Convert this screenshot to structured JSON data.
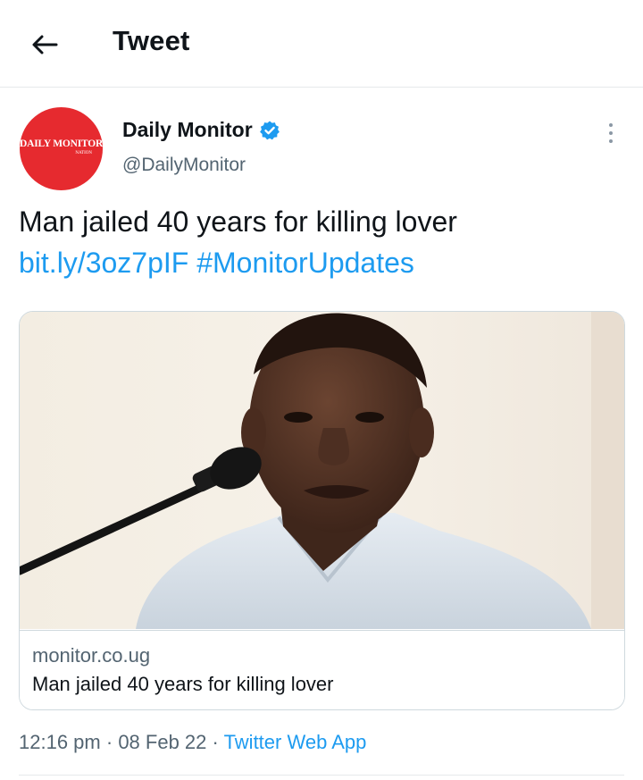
{
  "header": {
    "title": "Tweet",
    "back_icon": "back-arrow-icon"
  },
  "author": {
    "name": "Daily Monitor",
    "handle": "@DailyMonitor",
    "verified": true,
    "avatar_logo_main": "DAILY MONITOR",
    "avatar_logo_sub": "NATION",
    "avatar_color": "#e62a2f"
  },
  "tweet": {
    "text": "Man jailed 40 years for killing lover",
    "link": "bit.ly/3oz7pIF",
    "hashtag": "#MonitorUpdates"
  },
  "card": {
    "domain": "monitor.co.ug",
    "title": "Man jailed 40 years for killing lover",
    "image_alt": "man-speaking-at-microphone-photo"
  },
  "meta": {
    "time": "12:16 pm",
    "separator": "·",
    "date": "08 Feb 22",
    "source": "Twitter Web App"
  },
  "colors": {
    "link": "#1d9bf0",
    "secondary_text": "#536471",
    "border": "#cfd9de"
  }
}
